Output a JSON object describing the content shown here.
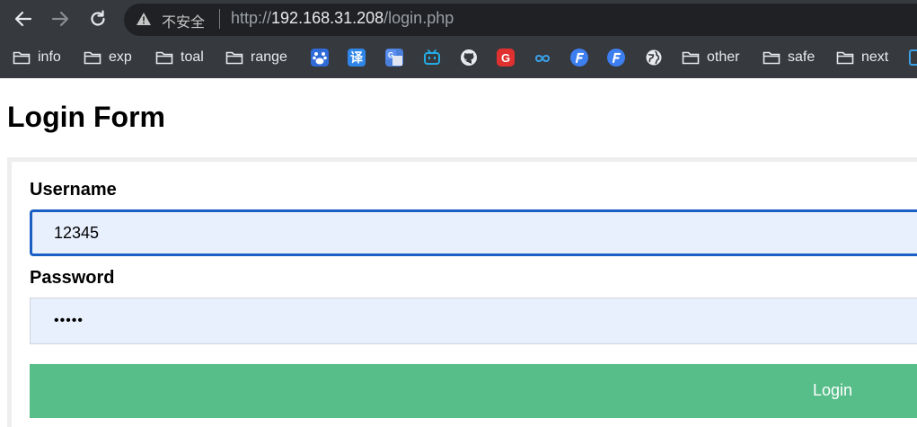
{
  "browser": {
    "security_label": "不安全",
    "url_scheme": "http://",
    "url_host": "192.168.31.208",
    "url_path": "/login.php"
  },
  "bookmarks": {
    "info": "info",
    "exp": "exp",
    "toal": "toal",
    "range": "range",
    "other": "other",
    "safe": "safe",
    "next": "next",
    "translate_glyph": "译",
    "g_glyph": "G"
  },
  "page": {
    "title": "Login Form",
    "username_label": "Username",
    "username_value": "12345",
    "password_label": "Password",
    "password_value": "•••••",
    "login_label": "Login"
  },
  "colors": {
    "chrome_bg": "#36393d",
    "input_bg": "#e8f0fe",
    "focus_border": "#1a5fc4",
    "button_bg": "#57bd89"
  }
}
